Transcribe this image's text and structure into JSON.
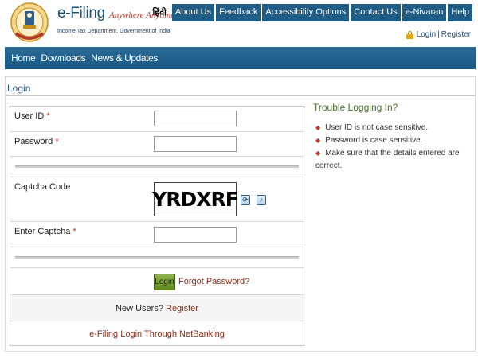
{
  "header": {
    "brand_name": "e-Filing",
    "brand_tagline": "Anywhere Anytime",
    "brand_subtitle": "Income Tax Department, Government of India",
    "language_link": "हिंदी",
    "top_links": [
      "About Us",
      "Feedback",
      "Accessibility Options",
      "Contact Us",
      "e-Nivaran",
      "Help"
    ],
    "login_link": "Login",
    "divider": "|",
    "register_link": "Register"
  },
  "main_nav": {
    "items": [
      "Home",
      "Downloads",
      "News & Updates"
    ]
  },
  "login_form": {
    "section_title": "Login",
    "user_id_label": "User ID",
    "password_label": "Password",
    "captcha_label": "Captcha Code",
    "captcha_text": "YRDXRF",
    "enter_captcha_label": "Enter Captcha",
    "required_marker": "*",
    "login_button": "Login",
    "forgot_password": "Forgot Password?",
    "new_users_text": "New Users?",
    "register_link": "Register",
    "netbanking_link": "e-Filing Login Through NetBanking"
  },
  "trouble": {
    "title": "Trouble Logging In?",
    "tips": [
      "User ID is not case sensitive.",
      "Password is case sensitive.",
      "Make sure that the details entered are correct."
    ]
  },
  "colors": {
    "nav_blue": "#1f5c86",
    "link_red": "#8b2f1e",
    "required_red": "#c0392b",
    "login_green": "#6f9a2a"
  },
  "icons": [
    "emblem-logo",
    "lock-icon",
    "refresh-captcha-icon",
    "audio-captcha-icon",
    "bullet-icon"
  ]
}
